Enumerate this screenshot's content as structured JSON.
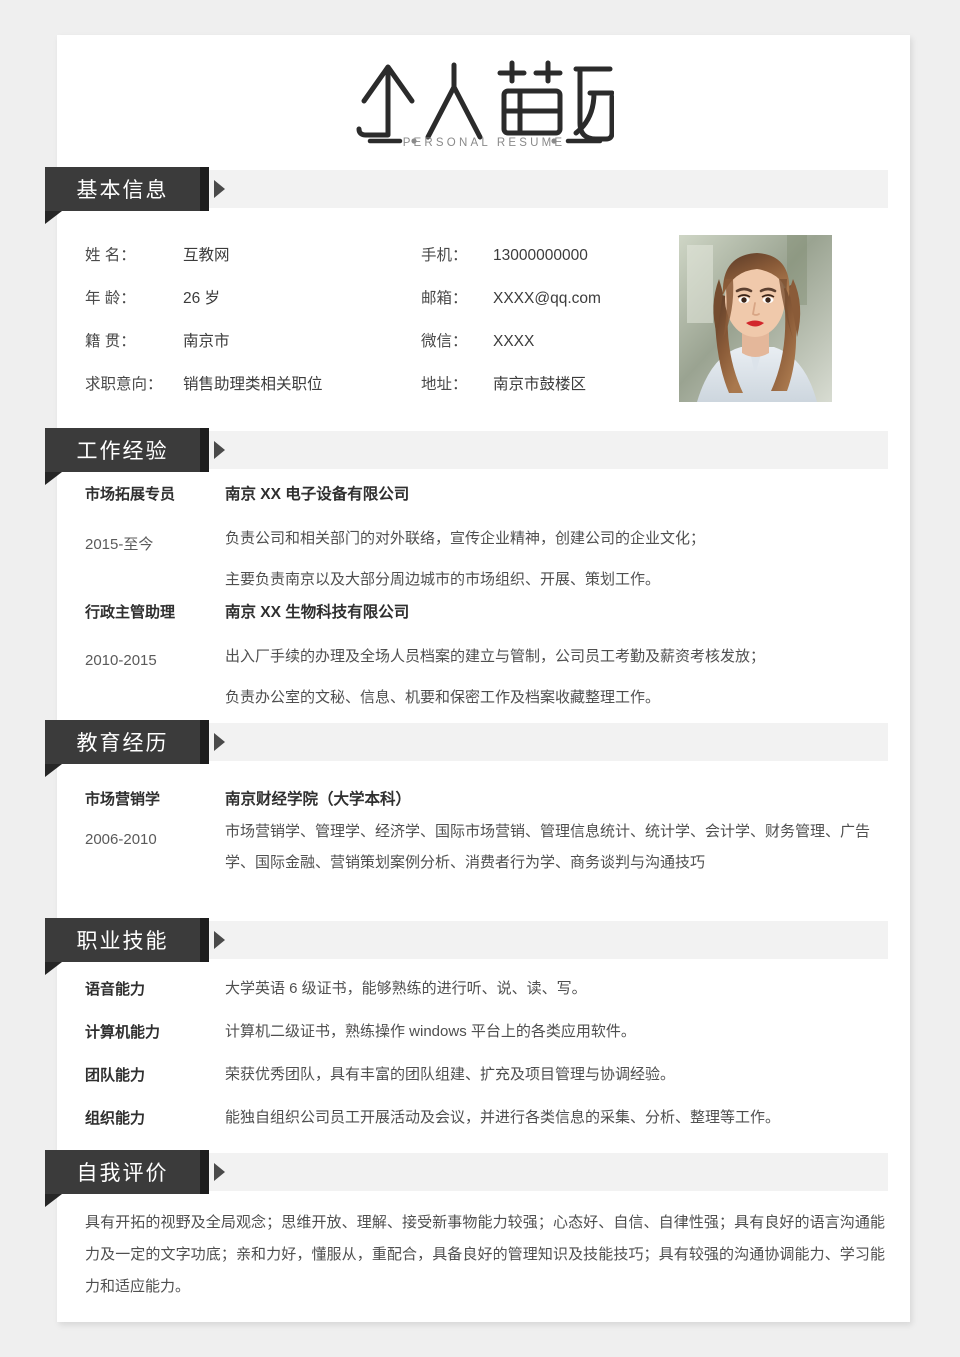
{
  "document": {
    "logo_title": "个人简历",
    "logo_subtitle": "PERSONAL RESUME",
    "accent_dark": "#3b3b3b",
    "band_gray": "#f2f2f2",
    "page_bg": "#ffffff",
    "canvas_bg": "#efefef"
  },
  "sections": {
    "basic_info": {
      "heading": "基本信息"
    },
    "work": {
      "heading": "工作经验"
    },
    "education": {
      "heading": "教育经历"
    },
    "skills": {
      "heading": "职业技能"
    },
    "self_eval": {
      "heading": "自我评价"
    }
  },
  "basic_info": {
    "left": [
      {
        "label": "姓      名：",
        "value": "互教网"
      },
      {
        "label": "年      龄：",
        "value": "26 岁"
      },
      {
        "label": "籍      贯：",
        "value": "南京市"
      },
      {
        "label": "求职意向：",
        "value": "销售助理类相关职位"
      }
    ],
    "right": [
      {
        "label": "手机：",
        "value": "13000000000"
      },
      {
        "label": "邮箱：",
        "value": "XXXX@qq.com"
      },
      {
        "label": "微信：",
        "value": "XXXX"
      },
      {
        "label": "地址：",
        "value": "南京市鼓楼区"
      }
    ],
    "photo_alt": "profile-photo"
  },
  "work_experience": [
    {
      "position": "市场拓展专员",
      "date": "2015-至今",
      "company": "南京 XX 电子设备有限公司",
      "duties": [
        "负责公司和相关部门的对外联络，宣传企业精神，创建公司的企业文化；",
        "主要负责南京以及大部分周边城市的市场组织、开展、策划工作。"
      ]
    },
    {
      "position": "行政主管助理",
      "date": "2010-2015",
      "company": "南京 XX 生物科技有限公司",
      "duties": [
        "出入厂手续的办理及全场人员档案的建立与管制，公司员工考勤及薪资考核发放；",
        "负责办公室的文秘、信息、机要和保密工作及档案收藏整理工作。"
      ]
    }
  ],
  "education": [
    {
      "major": "市场营销学",
      "date": "2006-2010",
      "school": "南京财经学院（大学本科）",
      "courses": "市场营销学、管理学、经济学、国际市场营销、管理信息统计、统计学、会计学、财务管理、广告学、国际金融、营销策划案例分析、消费者行为学、商务谈判与沟通技巧"
    }
  ],
  "skills": [
    {
      "label": "语音能力",
      "text": "大学英语 6 级证书，能够熟练的进行听、说、读、写。"
    },
    {
      "label": "计算机能力",
      "text": "计算机二级证书，熟练操作 windows 平台上的各类应用软件。"
    },
    {
      "label": "团队能力",
      "text": "荣获优秀团队，具有丰富的团队组建、扩充及项目管理与协调经验。"
    },
    {
      "label": "组织能力",
      "text": "能独自组织公司员工开展活动及会议，并进行各类信息的采集、分析、整理等工作。"
    }
  ],
  "self_evaluation": {
    "text": "具有开拓的视野及全局观念；思维开放、理解、接受新事物能力较强；心态好、自信、自律性强；具有良好的语言沟通能力及一定的文字功底；亲和力好，懂服从，重配合，具备良好的管理知识及技能技巧；具有较强的沟通协调能力、学习能力和适应能力。"
  }
}
